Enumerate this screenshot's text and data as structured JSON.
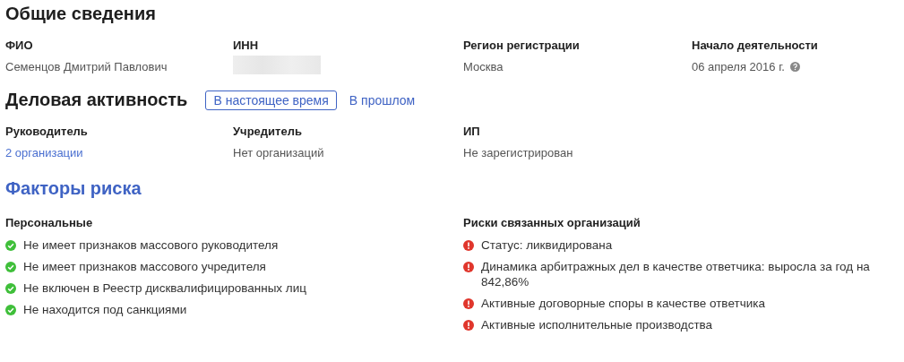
{
  "general": {
    "title": "Общие сведения",
    "fields": [
      {
        "label": "ФИО",
        "kind": "text",
        "value": "Семенцов Дмитрий Павлович"
      },
      {
        "label": "ИНН",
        "kind": "redacted"
      },
      {
        "label": "Регион регистрации",
        "kind": "text",
        "value": "Москва"
      },
      {
        "label": "Начало деятельности",
        "kind": "help",
        "value": "06 апреля 2016 г."
      }
    ]
  },
  "activity": {
    "title": "Деловая активность",
    "tabs": [
      {
        "label": "В настоящее время",
        "selected": true
      },
      {
        "label": "В прошлом",
        "selected": false
      }
    ],
    "fields": [
      {
        "label": "Руководитель",
        "kind": "link",
        "value": "2 организации"
      },
      {
        "label": "Учредитель",
        "kind": "text",
        "value": "Нет организаций"
      },
      {
        "label": "ИП",
        "kind": "text",
        "value": "Не зарегистрирован"
      }
    ]
  },
  "risks": {
    "title": "Факторы риска",
    "groups": [
      {
        "title": "Персональные",
        "items": [
          {
            "kind": "ok",
            "text": "Не имеет признаков массового руководителя"
          },
          {
            "kind": "ok",
            "text": "Не имеет признаков массового учредителя"
          },
          {
            "kind": "ok",
            "text": "Не включен в Реестр дисквалифицированных лиц"
          },
          {
            "kind": "ok",
            "text": "Не находится под санкциями"
          }
        ]
      },
      {
        "title": "Риски связанных организаций",
        "items": [
          {
            "kind": "warn",
            "text": "Статус: ликвидирована"
          },
          {
            "kind": "warn",
            "text": "Динамика арбитражных дел в качестве ответчика: выросла за год на 842,86%"
          },
          {
            "kind": "warn",
            "text": "Активные договорные споры в качестве ответчика"
          },
          {
            "kind": "warn",
            "text": "Активные исполнительные производства"
          }
        ]
      }
    ]
  }
}
